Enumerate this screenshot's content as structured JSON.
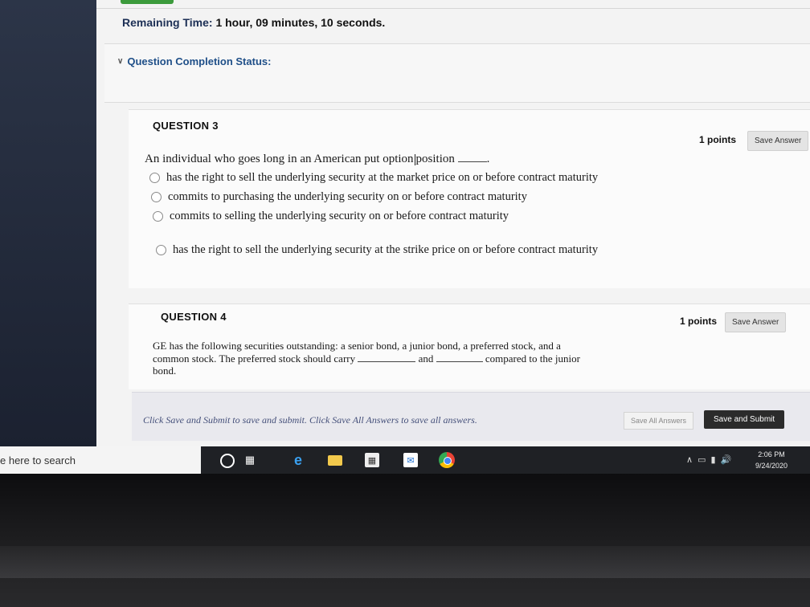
{
  "header": {
    "remaining_label": "Remaining Time:",
    "remaining_value": "1 hour, 09 minutes, 10 seconds.",
    "completion_status": "Question Completion Status:"
  },
  "questions": [
    {
      "title": "QUESTION 3",
      "points": "1 points",
      "save_label": "Save Answer",
      "text_before": "An individual who goes long in an American put option",
      "text_after": "position",
      "options": [
        "has the right to sell the underlying security at the market price on or before contract maturity",
        "commits to purchasing the underlying security on or before contract maturity",
        "commits to selling the underlying security on or before contract maturity",
        "has the right to sell the underlying security at the strike price on or before contract maturity"
      ]
    },
    {
      "title": "QUESTION 4",
      "points": "1 points",
      "save_label": "Save Answer",
      "line1": "GE has the following securities outstanding: a senior bond, a junior bond, a preferred stock, and a",
      "line2_a": "common stock. The preferred stock should carry",
      "line2_b": "and",
      "line2_c": "compared to the junior",
      "line3": "bond."
    }
  ],
  "footer": {
    "instructions": "Click Save and Submit to save and submit. Click Save All Answers to save all answers.",
    "save_all": "Save All Answers",
    "save_submit": "Save and Submit"
  },
  "taskbar": {
    "search_text": "e here to search",
    "icons": [
      "cortana-icon",
      "task-view-icon",
      "edge-icon",
      "file-explorer-icon",
      "store-icon",
      "mail-icon",
      "chrome-icon"
    ],
    "time": "2:06 PM",
    "date": "9/24/2020"
  }
}
